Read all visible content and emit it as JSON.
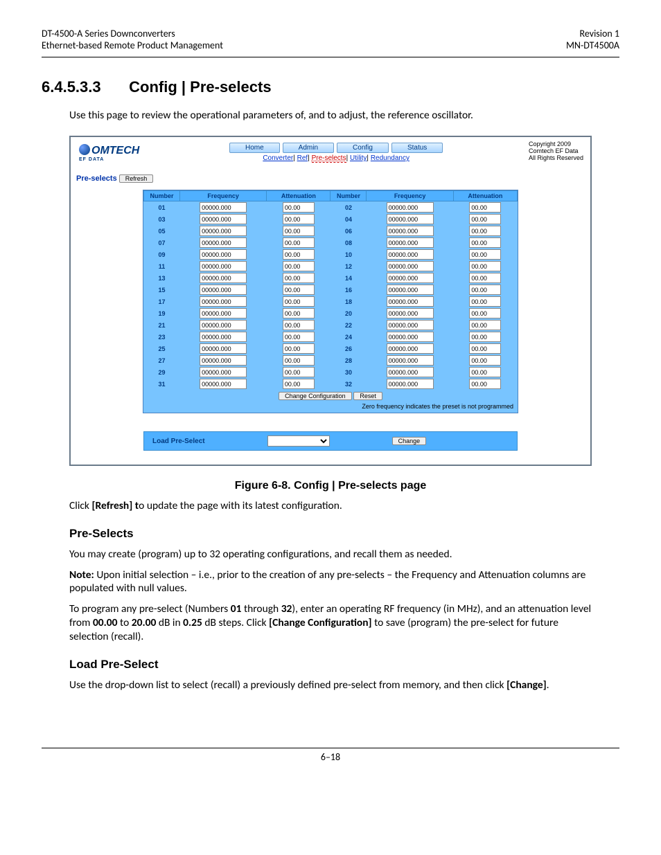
{
  "header": {
    "left_line1": "DT-4500-A Series Downconverters",
    "left_line2": "Ethernet-based Remote Product Management",
    "right_line1": "Revision 1",
    "right_line2": "MN-DT4500A"
  },
  "section": {
    "number": "6.4.5.3.3",
    "title": "Config | Pre-selects",
    "intro": "Use this page to review the operational parameters of, and to adjust, the reference oscillator."
  },
  "screenshot": {
    "logo_text": "OMTECH",
    "logo_sub": "EF DATA",
    "copyright": [
      "Copyright 2009",
      "Comtech EF Data",
      "All Rights Reserved"
    ],
    "main_tabs": [
      "Home",
      "Admin",
      "Config",
      "Status"
    ],
    "sub_tabs": {
      "items": [
        "Converter",
        "Ref",
        "Pre-selects",
        "Utility",
        "Redundancy"
      ],
      "active_index": 2
    },
    "preselects_label": "Pre-selects",
    "refresh_btn": "Refresh",
    "cols": {
      "number": "Number",
      "frequency": "Frequency",
      "attenuation": "Attenuation"
    },
    "freq_default": "00000.000",
    "attn_default": "00.00",
    "row_pairs": [
      [
        "01",
        "02"
      ],
      [
        "03",
        "04"
      ],
      [
        "05",
        "06"
      ],
      [
        "07",
        "08"
      ],
      [
        "09",
        "10"
      ],
      [
        "11",
        "12"
      ],
      [
        "13",
        "14"
      ],
      [
        "15",
        "16"
      ],
      [
        "17",
        "18"
      ],
      [
        "19",
        "20"
      ],
      [
        "21",
        "22"
      ],
      [
        "23",
        "24"
      ],
      [
        "25",
        "26"
      ],
      [
        "27",
        "28"
      ],
      [
        "29",
        "30"
      ],
      [
        "31",
        "32"
      ]
    ],
    "change_config_btn": "Change Configuration",
    "reset_btn": "Reset",
    "footnote": "Zero frequency indicates the preset is not programmed",
    "load_label": "Load Pre-Select",
    "change_btn": "Change"
  },
  "figure_caption": "Figure 6-8. Config | Pre-selects page",
  "body": {
    "refresh_text_pre": "Click ",
    "refresh_text_bold": "[Refresh] t",
    "refresh_text_post": "o update the page with its latest configuration.",
    "preselects_h": "Pre-Selects",
    "preselects_p1": "You may create (program) up to 32 operating configurations, and recall them as needed.",
    "note_label": "Note:",
    "note_text": " Upon initial selection –  i.e., prior to the creation of any pre-selects – the Frequency and Attenuation columns are populated with null values.",
    "prog_pre": "To program any pre-select (Numbers ",
    "prog_b1": "01",
    "prog_mid1": " through ",
    "prog_b2": "32",
    "prog_mid2": "), enter an operating RF frequency (in MHz), and an attenuation level from ",
    "prog_b3": "00.00",
    "prog_mid3": " to ",
    "prog_b4": "20.00",
    "prog_mid4": " dB in ",
    "prog_b5": "0.25",
    "prog_mid5": " dB steps. Click ",
    "prog_b6": "[Change Configuration]",
    "prog_post": " to save (program) the pre-select for future selection (recall).",
    "load_h": "Load Pre-Select",
    "load_p_pre": "Use the drop-down list to select (recall) a previously defined pre-select from memory, and then click ",
    "load_p_bold": "[Change]",
    "load_p_post": "."
  },
  "footer": {
    "page": "6–18"
  }
}
